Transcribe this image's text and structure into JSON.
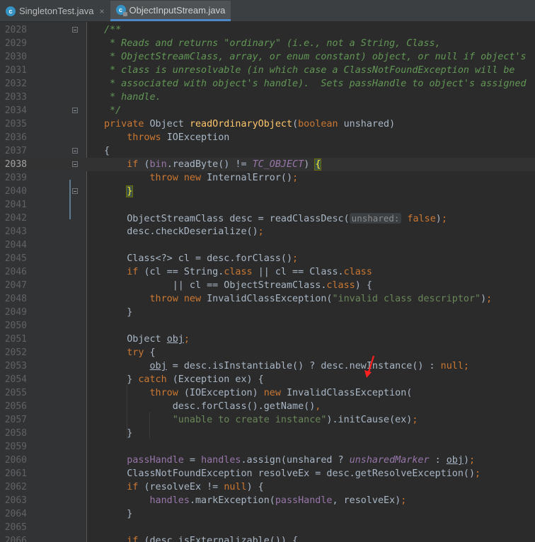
{
  "tabs": [
    {
      "label": "SingletonTest.java",
      "active": false,
      "icon": "class-file-icon"
    },
    {
      "label": "ObjectInputStream.java",
      "active": true,
      "icon": "class-file-locked-icon"
    }
  ],
  "close_glyph": "×",
  "caret_line": "2038",
  "lines": [
    {
      "num": "2028",
      "segs": [
        {
          "t": "/**",
          "c": "cm"
        }
      ]
    },
    {
      "num": "2029",
      "segs": [
        {
          "t": " * Reads and returns \"ordinary\" (i.e., not a String, Class,",
          "c": "cm"
        }
      ]
    },
    {
      "num": "2030",
      "segs": [
        {
          "t": " * ObjectStreamClass, array, or enum constant) object, or null if object's",
          "c": "cm"
        }
      ]
    },
    {
      "num": "2031",
      "segs": [
        {
          "t": " * class is unresolvable (in which case a ClassNotFoundException will be",
          "c": "cm"
        }
      ]
    },
    {
      "num": "2032",
      "segs": [
        {
          "t": " * associated with object's handle).  Sets passHandle to object's assigned",
          "c": "cm"
        }
      ]
    },
    {
      "num": "2033",
      "segs": [
        {
          "t": " * handle.",
          "c": "cm"
        }
      ]
    },
    {
      "num": "2034",
      "segs": [
        {
          "t": " */",
          "c": "cm"
        }
      ]
    },
    {
      "num": "2035",
      "segs": [
        {
          "t": "private ",
          "c": "k"
        },
        {
          "t": "Object "
        },
        {
          "t": "readOrdinaryObject",
          "c": "fn"
        },
        {
          "t": "("
        },
        {
          "t": "boolean ",
          "c": "k"
        },
        {
          "t": "unshared)"
        }
      ]
    },
    {
      "num": "2036",
      "segs": [
        {
          "t": "    "
        },
        {
          "t": "throws ",
          "c": "k"
        },
        {
          "t": "IOException"
        }
      ]
    },
    {
      "num": "2037",
      "segs": [
        {
          "t": "{"
        }
      ]
    },
    {
      "num": "2038",
      "segs": [
        {
          "t": "    "
        },
        {
          "t": "if ",
          "c": "k"
        },
        {
          "t": "("
        },
        {
          "t": "bin",
          "c": "fld"
        },
        {
          "t": ".readByte() != "
        },
        {
          "t": "TC_OBJECT",
          "c": "ci"
        },
        {
          "t": ") "
        },
        {
          "t": "{",
          "c": "br"
        }
      ]
    },
    {
      "num": "2039",
      "segs": [
        {
          "t": "        "
        },
        {
          "t": "throw new ",
          "c": "k"
        },
        {
          "t": "InternalError()"
        },
        {
          "t": ";",
          "c": "k"
        }
      ]
    },
    {
      "num": "2040",
      "segs": [
        {
          "t": "    "
        },
        {
          "t": "}",
          "c": "br"
        }
      ]
    },
    {
      "num": "2041",
      "segs": []
    },
    {
      "num": "2042",
      "segs": [
        {
          "t": "    ObjectStreamClass desc = readClassDesc("
        },
        {
          "t": "unshared:",
          "c": "hint"
        },
        {
          "t": " "
        },
        {
          "t": "false",
          "c": "k"
        },
        {
          "t": ")"
        },
        {
          "t": ";",
          "c": "k"
        }
      ]
    },
    {
      "num": "2043",
      "segs": [
        {
          "t": "    desc.checkDeserialize()"
        },
        {
          "t": ";",
          "c": "k"
        }
      ]
    },
    {
      "num": "2044",
      "segs": []
    },
    {
      "num": "2045",
      "segs": [
        {
          "t": "    Class<?> cl = desc.forClass()"
        },
        {
          "t": ";",
          "c": "k"
        }
      ]
    },
    {
      "num": "2046",
      "segs": [
        {
          "t": "    "
        },
        {
          "t": "if ",
          "c": "k"
        },
        {
          "t": "(cl == String."
        },
        {
          "t": "class ",
          "c": "k"
        },
        {
          "t": "|| cl == Class."
        },
        {
          "t": "class",
          "c": "k"
        }
      ]
    },
    {
      "num": "2047",
      "segs": [
        {
          "t": "            || cl == ObjectStreamClass."
        },
        {
          "t": "class",
          "c": "k"
        },
        {
          "t": ") {"
        }
      ]
    },
    {
      "num": "2048",
      "segs": [
        {
          "t": "        "
        },
        {
          "t": "throw new ",
          "c": "k"
        },
        {
          "t": "InvalidClassException("
        },
        {
          "t": "\"invalid class descriptor\"",
          "c": "s"
        },
        {
          "t": ")"
        },
        {
          "t": ";",
          "c": "k"
        }
      ]
    },
    {
      "num": "2049",
      "segs": [
        {
          "t": "    }"
        }
      ]
    },
    {
      "num": "2050",
      "segs": []
    },
    {
      "num": "2051",
      "segs": [
        {
          "t": "    Object "
        },
        {
          "t": "obj",
          "c": "u"
        },
        {
          "t": ";",
          "c": "k"
        }
      ]
    },
    {
      "num": "2052",
      "segs": [
        {
          "t": "    "
        },
        {
          "t": "try ",
          "c": "k"
        },
        {
          "t": "{"
        }
      ]
    },
    {
      "num": "2053",
      "segs": [
        {
          "t": "        "
        },
        {
          "t": "obj",
          "c": "u"
        },
        {
          "t": " = desc.isInstantiable() ? desc.newInstance() : "
        },
        {
          "t": "null",
          "c": "k"
        },
        {
          "t": ";",
          "c": "k"
        }
      ]
    },
    {
      "num": "2054",
      "segs": [
        {
          "t": "    } "
        },
        {
          "t": "catch ",
          "c": "k"
        },
        {
          "t": "(Exception ex) {"
        }
      ]
    },
    {
      "num": "2055",
      "segs": [
        {
          "t": "        "
        },
        {
          "t": "throw ",
          "c": "k"
        },
        {
          "t": "(IOException) "
        },
        {
          "t": "new ",
          "c": "k"
        },
        {
          "t": "InvalidClassException("
        }
      ]
    },
    {
      "num": "2056",
      "segs": [
        {
          "t": "            desc.forClass().getName()"
        },
        {
          "t": ",",
          "c": "k"
        }
      ]
    },
    {
      "num": "2057",
      "segs": [
        {
          "t": "            "
        },
        {
          "t": "\"unable to create instance\"",
          "c": "s"
        },
        {
          "t": ").initCause(ex)"
        },
        {
          "t": ";",
          "c": "k"
        }
      ]
    },
    {
      "num": "2058",
      "segs": [
        {
          "t": "    }"
        }
      ]
    },
    {
      "num": "2059",
      "segs": []
    },
    {
      "num": "2060",
      "segs": [
        {
          "t": "    "
        },
        {
          "t": "passHandle",
          "c": "fld"
        },
        {
          "t": " = "
        },
        {
          "t": "handles",
          "c": "fld"
        },
        {
          "t": ".assign(unshared ? "
        },
        {
          "t": "unsharedMarker",
          "c": "ci"
        },
        {
          "t": " : "
        },
        {
          "t": "obj",
          "c": "u"
        },
        {
          "t": ")"
        },
        {
          "t": ";",
          "c": "k"
        }
      ]
    },
    {
      "num": "2061",
      "segs": [
        {
          "t": "    ClassNotFoundException resolveEx = desc.getResolveException()"
        },
        {
          "t": ";",
          "c": "k"
        }
      ]
    },
    {
      "num": "2062",
      "segs": [
        {
          "t": "    "
        },
        {
          "t": "if ",
          "c": "k"
        },
        {
          "t": "(resolveEx != "
        },
        {
          "t": "null",
          "c": "k"
        },
        {
          "t": ") {"
        }
      ]
    },
    {
      "num": "2063",
      "segs": [
        {
          "t": "        "
        },
        {
          "t": "handles",
          "c": "fld"
        },
        {
          "t": ".markException("
        },
        {
          "t": "passHandle",
          "c": "fld"
        },
        {
          "t": ", resolveEx)"
        },
        {
          "t": ";",
          "c": "k"
        }
      ]
    },
    {
      "num": "2064",
      "segs": [
        {
          "t": "    }"
        }
      ]
    },
    {
      "num": "2065",
      "segs": []
    },
    {
      "num": "2066",
      "segs": [
        {
          "t": "    "
        },
        {
          "t": "if ",
          "c": "k"
        },
        {
          "t": "(desc.isExternalizable()) {"
        }
      ]
    }
  ],
  "fold_lines": [
    "2028",
    "2034",
    "2037",
    "2038",
    "2040"
  ],
  "colors": {
    "background": "#2b2b2b",
    "keyword": "#cc7832",
    "comment": "#629755",
    "string": "#6a8759",
    "method": "#ffc66d",
    "field": "#9876aa",
    "annotation_arrow": "#ff2020"
  }
}
